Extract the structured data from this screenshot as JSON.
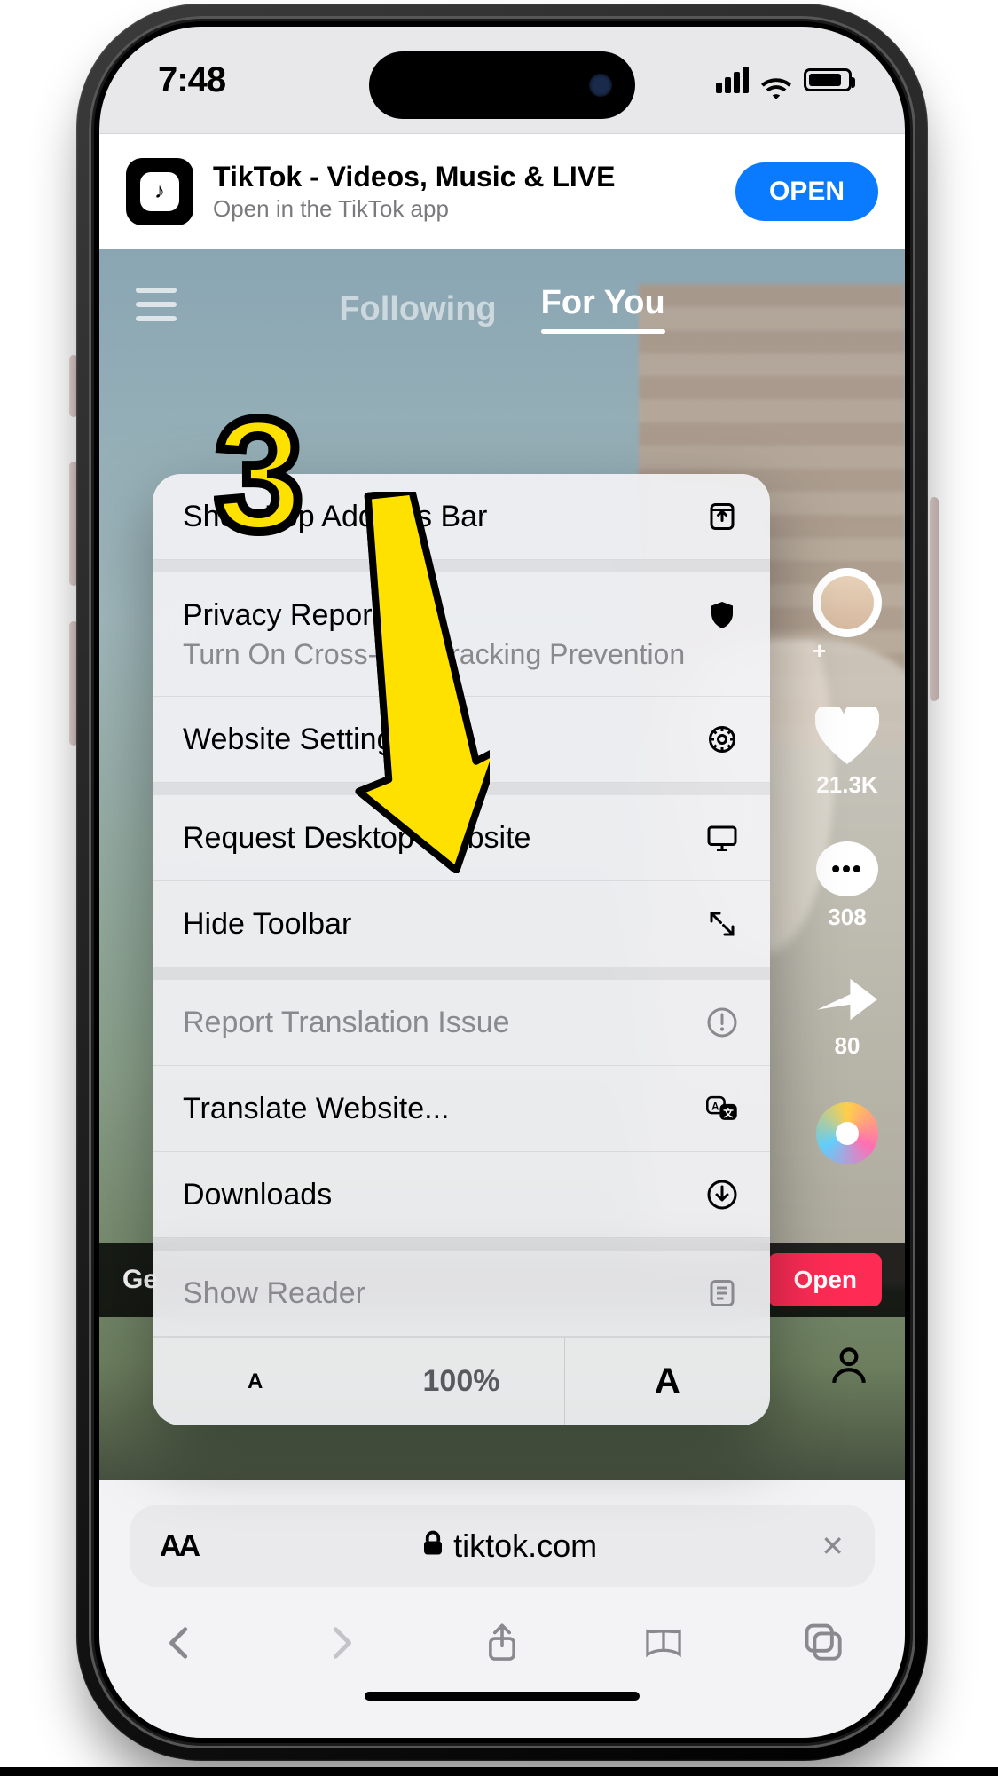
{
  "status": {
    "time": "7:48"
  },
  "smartbanner": {
    "title": "TikTok - Videos, Music & LIVE",
    "subtitle": "Open in the TikTok app",
    "open_label": "OPEN",
    "app_glyph": "♪"
  },
  "tiktok": {
    "nav": {
      "following": "Following",
      "for_you": "For You"
    },
    "rail": {
      "likes": "21.3K",
      "comments": "308",
      "shares": "80"
    },
    "caption_prefix": "@",
    "bottom_strip": {
      "left": "Ge",
      "open": "Open"
    }
  },
  "callout": {
    "number": "3"
  },
  "aa_menu": {
    "items": [
      {
        "label": "Show Top Address Bar",
        "icon": "top-bar"
      },
      {
        "label": "Privacy Report",
        "sub": "Turn On Cross-Site Tracking Prevention",
        "icon": "privacy"
      },
      {
        "label": "Website Settings",
        "icon": "gear"
      },
      {
        "label": "Request Desktop Website",
        "icon": "desktop"
      },
      {
        "label": "Hide Toolbar",
        "icon": "expand"
      },
      {
        "label": "Report Translation Issue",
        "icon": "alert",
        "disabled": true
      },
      {
        "label": "Translate Website...",
        "icon": "translate"
      },
      {
        "label": "Downloads",
        "icon": "download"
      },
      {
        "label": "Show Reader",
        "icon": "reader",
        "disabled": true
      }
    ],
    "zoom": {
      "small": "A",
      "pct": "100%",
      "big": "A"
    }
  },
  "safari": {
    "address": {
      "aa": "AA",
      "lock": "🔒",
      "domain": "tiktok.com",
      "close": "✕"
    }
  }
}
